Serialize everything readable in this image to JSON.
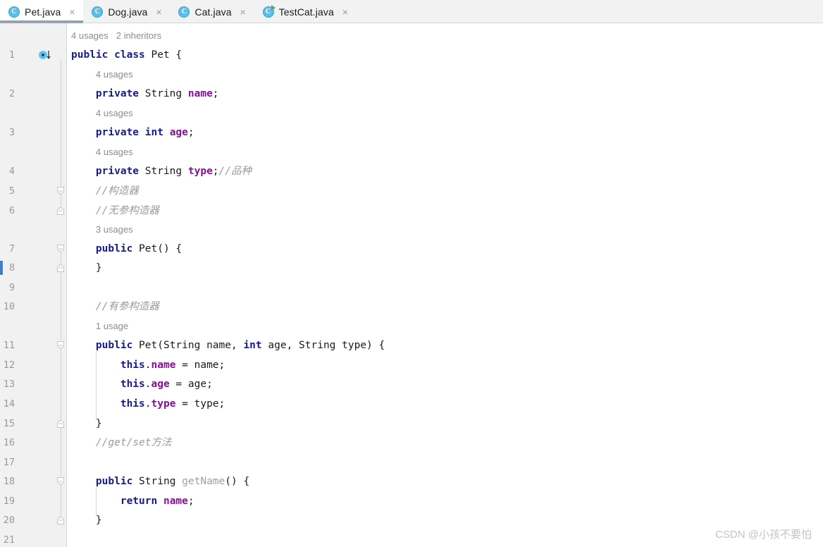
{
  "window": {
    "app": "IntelliJ IDEA Editor",
    "active_file": "Pet.java"
  },
  "tabs": [
    {
      "label": "Pet.java",
      "icon": "java-class-icon",
      "close_glyph": "×",
      "letter": "C",
      "active": true,
      "runnable": false
    },
    {
      "label": "Dog.java",
      "icon": "java-class-icon",
      "close_glyph": "×",
      "letter": "C",
      "active": false,
      "runnable": false
    },
    {
      "label": "Cat.java",
      "icon": "java-class-icon",
      "close_glyph": "×",
      "letter": "C",
      "active": false,
      "runnable": false
    },
    {
      "label": "TestCat.java",
      "icon": "java-runnable-class-icon",
      "close_glyph": "×",
      "letter": "C",
      "active": false,
      "runnable": true
    }
  ],
  "gutter": {
    "line_numbers": [
      "1",
      "2",
      "3",
      "4",
      "5",
      "6",
      "7",
      "8",
      "9",
      "10",
      "11",
      "12",
      "13",
      "14",
      "15",
      "16",
      "17",
      "18",
      "19",
      "20",
      "21"
    ],
    "inheritance_marker_line": 1,
    "inheritance_marker_name": "overridden-by-subclasses-icon",
    "changed_line_marker": 8,
    "fold_marker_lines": [
      5,
      6,
      7,
      8,
      11,
      15,
      18,
      20
    ]
  },
  "colors": {
    "keyword": "#1a1a8c",
    "field": "#871094",
    "comment": "#9a9a9a",
    "plain": "#1a1a1a",
    "unused_method": "#a0a0a0",
    "gutter_bg": "#f1f1f1",
    "tab_bg": "#f2f2f2",
    "active_tab_underline": "#98a2b3",
    "changed_line": "#3d7ed1",
    "java_icon": "#59bfe8",
    "run_arrow": "#59a869"
  },
  "code": {
    "file_name": "Pet.java",
    "inlay_hints": [
      {
        "line": 1,
        "text": "4 usages",
        "second": "2 inheritors"
      },
      {
        "line": 2,
        "text": "4 usages",
        "second": ""
      },
      {
        "line": 3,
        "text": "4 usages",
        "second": ""
      },
      {
        "line": 4,
        "text": "4 usages",
        "second": ""
      },
      {
        "line": 7,
        "text": "3 usages",
        "second": ""
      },
      {
        "line": 11,
        "text": "1 usage",
        "second": ""
      }
    ],
    "lines": [
      {
        "n": 1,
        "tokens": [
          {
            "t": "public",
            "c": "kw"
          },
          {
            "t": " ",
            "c": "pln"
          },
          {
            "t": "class",
            "c": "kw"
          },
          {
            "t": " Pet {",
            "c": "pln"
          }
        ]
      },
      {
        "n": 2,
        "tokens": [
          {
            "t": "    ",
            "c": "pln"
          },
          {
            "t": "private",
            "c": "kw"
          },
          {
            "t": " String ",
            "c": "pln"
          },
          {
            "t": "name",
            "c": "fld"
          },
          {
            "t": ";",
            "c": "pln"
          }
        ]
      },
      {
        "n": 3,
        "tokens": [
          {
            "t": "    ",
            "c": "pln"
          },
          {
            "t": "private",
            "c": "kw"
          },
          {
            "t": " ",
            "c": "pln"
          },
          {
            "t": "int",
            "c": "kw"
          },
          {
            "t": " ",
            "c": "pln"
          },
          {
            "t": "age",
            "c": "fld"
          },
          {
            "t": ";",
            "c": "pln"
          }
        ]
      },
      {
        "n": 4,
        "tokens": [
          {
            "t": "    ",
            "c": "pln"
          },
          {
            "t": "private",
            "c": "kw"
          },
          {
            "t": " String ",
            "c": "pln"
          },
          {
            "t": "type",
            "c": "fld"
          },
          {
            "t": ";",
            "c": "pln"
          },
          {
            "t": "//品种",
            "c": "cmt"
          }
        ]
      },
      {
        "n": 5,
        "tokens": [
          {
            "t": "    ",
            "c": "pln"
          },
          {
            "t": "//构造器",
            "c": "cmt"
          }
        ]
      },
      {
        "n": 6,
        "tokens": [
          {
            "t": "    ",
            "c": "pln"
          },
          {
            "t": "//无参构造器",
            "c": "cmt"
          }
        ]
      },
      {
        "n": 7,
        "tokens": [
          {
            "t": "    ",
            "c": "pln"
          },
          {
            "t": "public",
            "c": "kw"
          },
          {
            "t": " Pet() {",
            "c": "pln"
          }
        ]
      },
      {
        "n": 8,
        "tokens": [
          {
            "t": "    }",
            "c": "pln"
          }
        ]
      },
      {
        "n": 9,
        "tokens": [
          {
            "t": "",
            "c": "pln"
          }
        ]
      },
      {
        "n": 10,
        "tokens": [
          {
            "t": "    ",
            "c": "pln"
          },
          {
            "t": "//有参构造器",
            "c": "cmt"
          }
        ]
      },
      {
        "n": 11,
        "tokens": [
          {
            "t": "    ",
            "c": "pln"
          },
          {
            "t": "public",
            "c": "kw"
          },
          {
            "t": " Pet(String name, ",
            "c": "pln"
          },
          {
            "t": "int",
            "c": "kw"
          },
          {
            "t": " age, String type) {",
            "c": "pln"
          }
        ]
      },
      {
        "n": 12,
        "tokens": [
          {
            "t": "        ",
            "c": "pln"
          },
          {
            "t": "this",
            "c": "kw"
          },
          {
            "t": ".",
            "c": "pln"
          },
          {
            "t": "name",
            "c": "fld"
          },
          {
            "t": " = name;",
            "c": "pln"
          }
        ]
      },
      {
        "n": 13,
        "tokens": [
          {
            "t": "        ",
            "c": "pln"
          },
          {
            "t": "this",
            "c": "kw"
          },
          {
            "t": ".",
            "c": "pln"
          },
          {
            "t": "age",
            "c": "fld"
          },
          {
            "t": " = age;",
            "c": "pln"
          }
        ]
      },
      {
        "n": 14,
        "tokens": [
          {
            "t": "        ",
            "c": "pln"
          },
          {
            "t": "this",
            "c": "kw"
          },
          {
            "t": ".",
            "c": "pln"
          },
          {
            "t": "type",
            "c": "fld"
          },
          {
            "t": " = type;",
            "c": "pln"
          }
        ]
      },
      {
        "n": 15,
        "tokens": [
          {
            "t": "    }",
            "c": "pln"
          }
        ]
      },
      {
        "n": 16,
        "tokens": [
          {
            "t": "    ",
            "c": "pln"
          },
          {
            "t": "//get/set方法",
            "c": "cmt"
          }
        ]
      },
      {
        "n": 17,
        "tokens": [
          {
            "t": "",
            "c": "pln"
          }
        ]
      },
      {
        "n": 18,
        "tokens": [
          {
            "t": "    ",
            "c": "pln"
          },
          {
            "t": "public",
            "c": "kw"
          },
          {
            "t": " String ",
            "c": "pln"
          },
          {
            "t": "getName",
            "c": "gry"
          },
          {
            "t": "() {",
            "c": "pln"
          }
        ]
      },
      {
        "n": 19,
        "tokens": [
          {
            "t": "        ",
            "c": "pln"
          },
          {
            "t": "return",
            "c": "kw"
          },
          {
            "t": " ",
            "c": "pln"
          },
          {
            "t": "name",
            "c": "fld"
          },
          {
            "t": ";",
            "c": "pln"
          }
        ]
      },
      {
        "n": 20,
        "tokens": [
          {
            "t": "    }",
            "c": "pln"
          }
        ]
      },
      {
        "n": 21,
        "tokens": [
          {
            "t": "",
            "c": "pln"
          }
        ]
      }
    ]
  },
  "watermark": {
    "text": "CSDN @小孩不要怕"
  }
}
